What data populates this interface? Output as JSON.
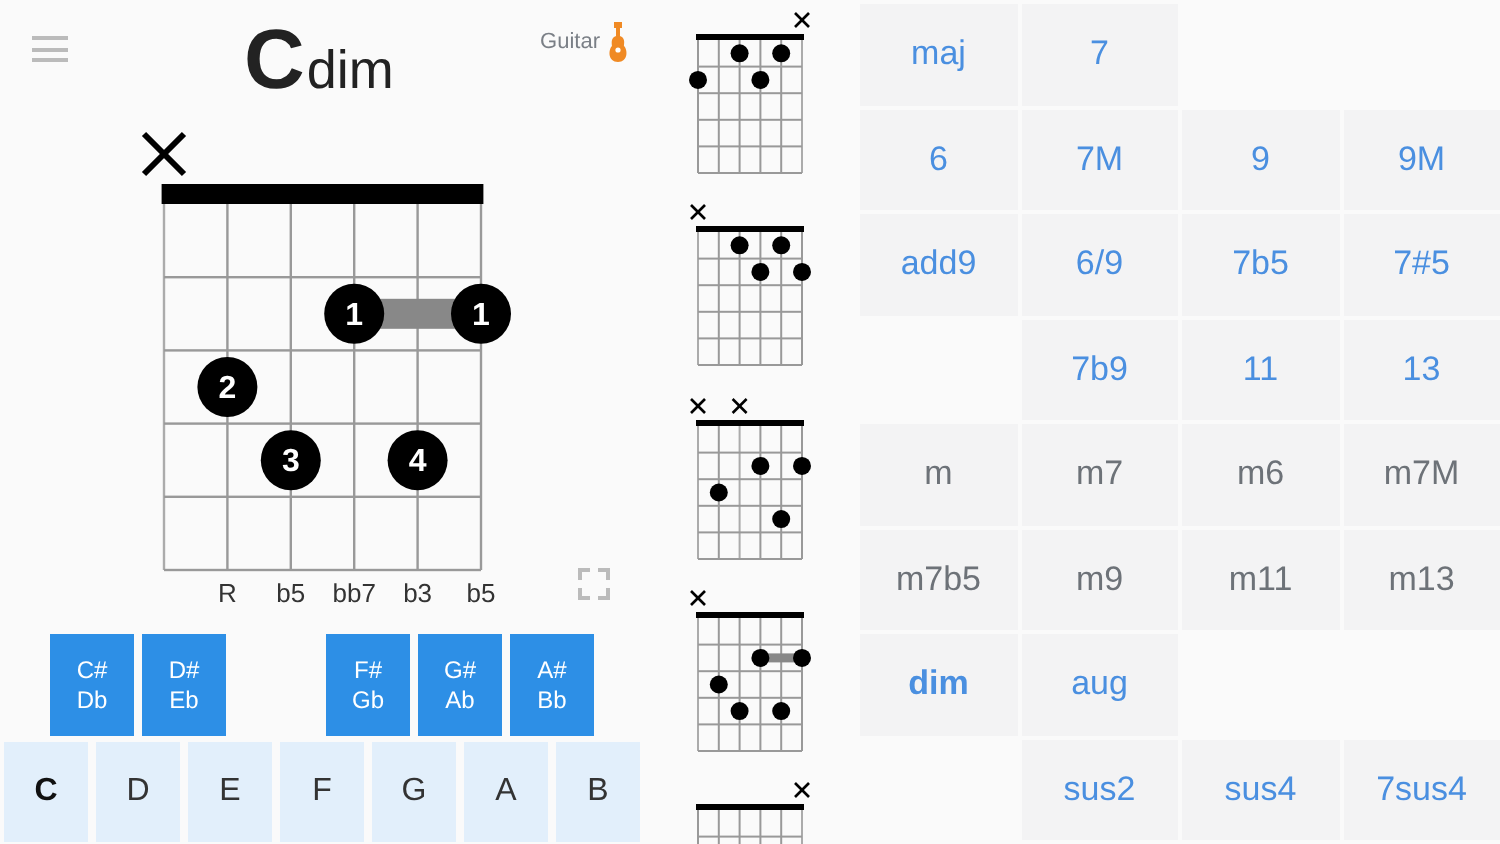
{
  "header": {
    "root": "C",
    "quality": "dim",
    "instrument": "Guitar"
  },
  "diagram": {
    "strings": [
      {
        "muted": true
      },
      {
        "muted": false,
        "interval": "R"
      },
      {
        "muted": false,
        "interval": "b5"
      },
      {
        "muted": false,
        "interval": "bb7"
      },
      {
        "muted": false,
        "interval": "b3"
      },
      {
        "muted": false,
        "interval": "b5"
      }
    ],
    "frets": [
      {
        "barre": false,
        "strings": [
          {
            "pressed": false
          },
          {
            "pressed": false
          },
          {
            "pressed": false
          },
          {
            "pressed": false
          },
          {
            "pressed": false
          },
          {
            "pressed": false
          }
        ]
      },
      {
        "barre": true,
        "strings": [
          {
            "pressed": false
          },
          {
            "pressed": false
          },
          {
            "pressed": false
          },
          {
            "pressed": true,
            "finger": "1"
          },
          {
            "pressed": false
          },
          {
            "pressed": true,
            "finger": "1"
          }
        ]
      },
      {
        "barre": false,
        "strings": [
          {
            "pressed": false
          },
          {
            "pressed": true,
            "finger": "2"
          },
          {
            "pressed": false
          },
          {
            "pressed": false
          },
          {
            "pressed": false
          },
          {
            "pressed": false
          }
        ]
      },
      {
        "barre": false,
        "strings": [
          {
            "pressed": false
          },
          {
            "pressed": false
          },
          {
            "pressed": true,
            "finger": "3"
          },
          {
            "pressed": false
          },
          {
            "pressed": true,
            "finger": "4"
          },
          {
            "pressed": false
          }
        ]
      },
      {
        "barre": false,
        "strings": [
          {
            "pressed": false
          },
          {
            "pressed": false
          },
          {
            "pressed": false
          },
          {
            "pressed": false
          },
          {
            "pressed": false
          },
          {
            "pressed": false
          }
        ]
      }
    ]
  },
  "black_keys": [
    {
      "sharp": "C#",
      "flat": "Db"
    },
    {
      "sharp": "D#",
      "flat": "Eb"
    },
    {
      "sharp": "F#",
      "flat": "Gb"
    },
    {
      "sharp": "G#",
      "flat": "Ab"
    },
    {
      "sharp": "A#",
      "flat": "Bb"
    }
  ],
  "white_keys": [
    {
      "label": "C",
      "selected": true
    },
    {
      "label": "D",
      "selected": false
    },
    {
      "label": "E",
      "selected": false
    },
    {
      "label": "F",
      "selected": false
    },
    {
      "label": "G",
      "selected": false
    },
    {
      "label": "A",
      "selected": false
    },
    {
      "label": "B",
      "selected": false
    }
  ],
  "variations": [
    {
      "strings": [
        {
          "muted": false
        },
        {
          "muted": false
        },
        {
          "muted": false
        },
        {
          "muted": false
        },
        {
          "muted": false
        },
        {
          "muted": true
        }
      ],
      "frets": [
        {
          "barre": false,
          "strings": [
            {
              "pressed": false
            },
            {
              "pressed": false
            },
            {
              "pressed": true
            },
            {
              "pressed": false
            },
            {
              "pressed": true
            },
            {
              "pressed": false
            }
          ]
        },
        {
          "barre": false,
          "strings": [
            {
              "pressed": true
            },
            {
              "pressed": false
            },
            {
              "pressed": false
            },
            {
              "pressed": true
            },
            {
              "pressed": false
            },
            {
              "pressed": false
            }
          ]
        },
        {
          "barre": false,
          "strings": [
            {
              "pressed": false
            },
            {
              "pressed": false
            },
            {
              "pressed": false
            },
            {
              "pressed": false
            },
            {
              "pressed": false
            },
            {
              "pressed": false
            }
          ]
        },
        {
          "barre": false,
          "strings": [
            {
              "pressed": false
            },
            {
              "pressed": false
            },
            {
              "pressed": false
            },
            {
              "pressed": false
            },
            {
              "pressed": false
            },
            {
              "pressed": false
            }
          ]
        },
        {
          "barre": false,
          "strings": [
            {
              "pressed": false
            },
            {
              "pressed": false
            },
            {
              "pressed": false
            },
            {
              "pressed": false
            },
            {
              "pressed": false
            },
            {
              "pressed": false
            }
          ]
        }
      ]
    },
    {
      "strings": [
        {
          "muted": true
        },
        {
          "muted": false
        },
        {
          "muted": false
        },
        {
          "muted": false
        },
        {
          "muted": false
        },
        {
          "muted": false
        }
      ],
      "frets": [
        {
          "barre": false,
          "strings": [
            {
              "pressed": false
            },
            {
              "pressed": false
            },
            {
              "pressed": true
            },
            {
              "pressed": false
            },
            {
              "pressed": true
            },
            {
              "pressed": false
            }
          ]
        },
        {
          "barre": false,
          "strings": [
            {
              "pressed": false
            },
            {
              "pressed": false
            },
            {
              "pressed": false
            },
            {
              "pressed": true
            },
            {
              "pressed": false
            },
            {
              "pressed": true
            }
          ]
        },
        {
          "barre": false,
          "strings": [
            {
              "pressed": false
            },
            {
              "pressed": false
            },
            {
              "pressed": false
            },
            {
              "pressed": false
            },
            {
              "pressed": false
            },
            {
              "pressed": false
            }
          ]
        },
        {
          "barre": false,
          "strings": [
            {
              "pressed": false
            },
            {
              "pressed": false
            },
            {
              "pressed": false
            },
            {
              "pressed": false
            },
            {
              "pressed": false
            },
            {
              "pressed": false
            }
          ]
        },
        {
          "barre": false,
          "strings": [
            {
              "pressed": false
            },
            {
              "pressed": false
            },
            {
              "pressed": false
            },
            {
              "pressed": false
            },
            {
              "pressed": false
            },
            {
              "pressed": false
            }
          ]
        }
      ]
    },
    {
      "strings": [
        {
          "muted": true
        },
        {
          "muted": false
        },
        {
          "muted": true
        },
        {
          "muted": false
        },
        {
          "muted": false
        },
        {
          "muted": false
        }
      ],
      "frets": [
        {
          "barre": false,
          "strings": [
            {
              "pressed": false
            },
            {
              "pressed": false
            },
            {
              "pressed": false
            },
            {
              "pressed": false
            },
            {
              "pressed": false
            },
            {
              "pressed": false
            }
          ]
        },
        {
          "barre": false,
          "strings": [
            {
              "pressed": false
            },
            {
              "pressed": false
            },
            {
              "pressed": false
            },
            {
              "pressed": true
            },
            {
              "pressed": false
            },
            {
              "pressed": true
            }
          ]
        },
        {
          "barre": false,
          "strings": [
            {
              "pressed": false
            },
            {
              "pressed": true
            },
            {
              "pressed": false
            },
            {
              "pressed": false
            },
            {
              "pressed": false
            },
            {
              "pressed": false
            }
          ]
        },
        {
          "barre": false,
          "strings": [
            {
              "pressed": false
            },
            {
              "pressed": false
            },
            {
              "pressed": false
            },
            {
              "pressed": false
            },
            {
              "pressed": true
            },
            {
              "pressed": false
            }
          ]
        },
        {
          "barre": false,
          "strings": [
            {
              "pressed": false
            },
            {
              "pressed": false
            },
            {
              "pressed": false
            },
            {
              "pressed": false
            },
            {
              "pressed": false
            },
            {
              "pressed": false
            }
          ]
        }
      ]
    },
    {
      "strings": [
        {
          "muted": true
        },
        {
          "muted": false
        },
        {
          "muted": false
        },
        {
          "muted": false
        },
        {
          "muted": false
        },
        {
          "muted": false
        }
      ],
      "frets": [
        {
          "barre": false,
          "strings": [
            {
              "pressed": false
            },
            {
              "pressed": false
            },
            {
              "pressed": false
            },
            {
              "pressed": false
            },
            {
              "pressed": false
            },
            {
              "pressed": false
            }
          ]
        },
        {
          "barre": true,
          "strings": [
            {
              "pressed": false
            },
            {
              "pressed": false
            },
            {
              "pressed": false
            },
            {
              "pressed": true
            },
            {
              "pressed": false
            },
            {
              "pressed": true
            }
          ]
        },
        {
          "barre": false,
          "strings": [
            {
              "pressed": false
            },
            {
              "pressed": true
            },
            {
              "pressed": false
            },
            {
              "pressed": false
            },
            {
              "pressed": false
            },
            {
              "pressed": false
            }
          ]
        },
        {
          "barre": false,
          "strings": [
            {
              "pressed": false
            },
            {
              "pressed": false
            },
            {
              "pressed": true
            },
            {
              "pressed": false
            },
            {
              "pressed": true
            },
            {
              "pressed": false
            }
          ]
        },
        {
          "barre": false,
          "strings": [
            {
              "pressed": false
            },
            {
              "pressed": false
            },
            {
              "pressed": false
            },
            {
              "pressed": false
            },
            {
              "pressed": false
            },
            {
              "pressed": false
            }
          ]
        }
      ]
    },
    {
      "strings": [
        {
          "muted": false
        },
        {
          "muted": false
        },
        {
          "muted": false
        },
        {
          "muted": false
        },
        {
          "muted": false
        },
        {
          "muted": true
        }
      ]
    }
  ],
  "chord_types": [
    [
      {
        "kind": "major",
        "label": "maj",
        "selected": false
      },
      {
        "kind": "major",
        "label": "7",
        "selected": false
      },
      {
        "kind": "blank"
      },
      {
        "kind": "blank"
      }
    ],
    [
      {
        "kind": "major",
        "label": "6",
        "selected": false
      },
      {
        "kind": "major",
        "label": "7M",
        "selected": false
      },
      {
        "kind": "major",
        "label": "9",
        "selected": false
      },
      {
        "kind": "major",
        "label": "9M",
        "selected": false
      }
    ],
    [
      {
        "kind": "major",
        "label": "add9",
        "selected": false
      },
      {
        "kind": "major",
        "label": "6/9",
        "selected": false
      },
      {
        "kind": "major",
        "label": "7b5",
        "selected": false
      },
      {
        "kind": "major",
        "label": "7#5",
        "selected": false
      }
    ],
    [
      {
        "kind": "blank"
      },
      {
        "kind": "major",
        "label": "7b9",
        "selected": false
      },
      {
        "kind": "major",
        "label": "11",
        "selected": false
      },
      {
        "kind": "major",
        "label": "13",
        "selected": false
      }
    ],
    [
      {
        "kind": "minor",
        "label": "m",
        "selected": false
      },
      {
        "kind": "minor",
        "label": "m7",
        "selected": false
      },
      {
        "kind": "minor",
        "label": "m6",
        "selected": false
      },
      {
        "kind": "minor",
        "label": "m7M",
        "selected": false
      }
    ],
    [
      {
        "kind": "minor",
        "label": "m7b5",
        "selected": false
      },
      {
        "kind": "minor",
        "label": "m9",
        "selected": false
      },
      {
        "kind": "minor",
        "label": "m11",
        "selected": false
      },
      {
        "kind": "minor",
        "label": "m13",
        "selected": false
      }
    ],
    [
      {
        "kind": "major",
        "label": "dim",
        "selected": true
      },
      {
        "kind": "major",
        "label": "aug",
        "selected": false
      },
      {
        "kind": "blank"
      },
      {
        "kind": "blank"
      }
    ],
    [
      {
        "kind": "blank"
      },
      {
        "kind": "major",
        "label": "sus2",
        "selected": false
      },
      {
        "kind": "major",
        "label": "sus4",
        "selected": false
      },
      {
        "kind": "major",
        "label": "7sus4",
        "selected": false
      }
    ]
  ]
}
